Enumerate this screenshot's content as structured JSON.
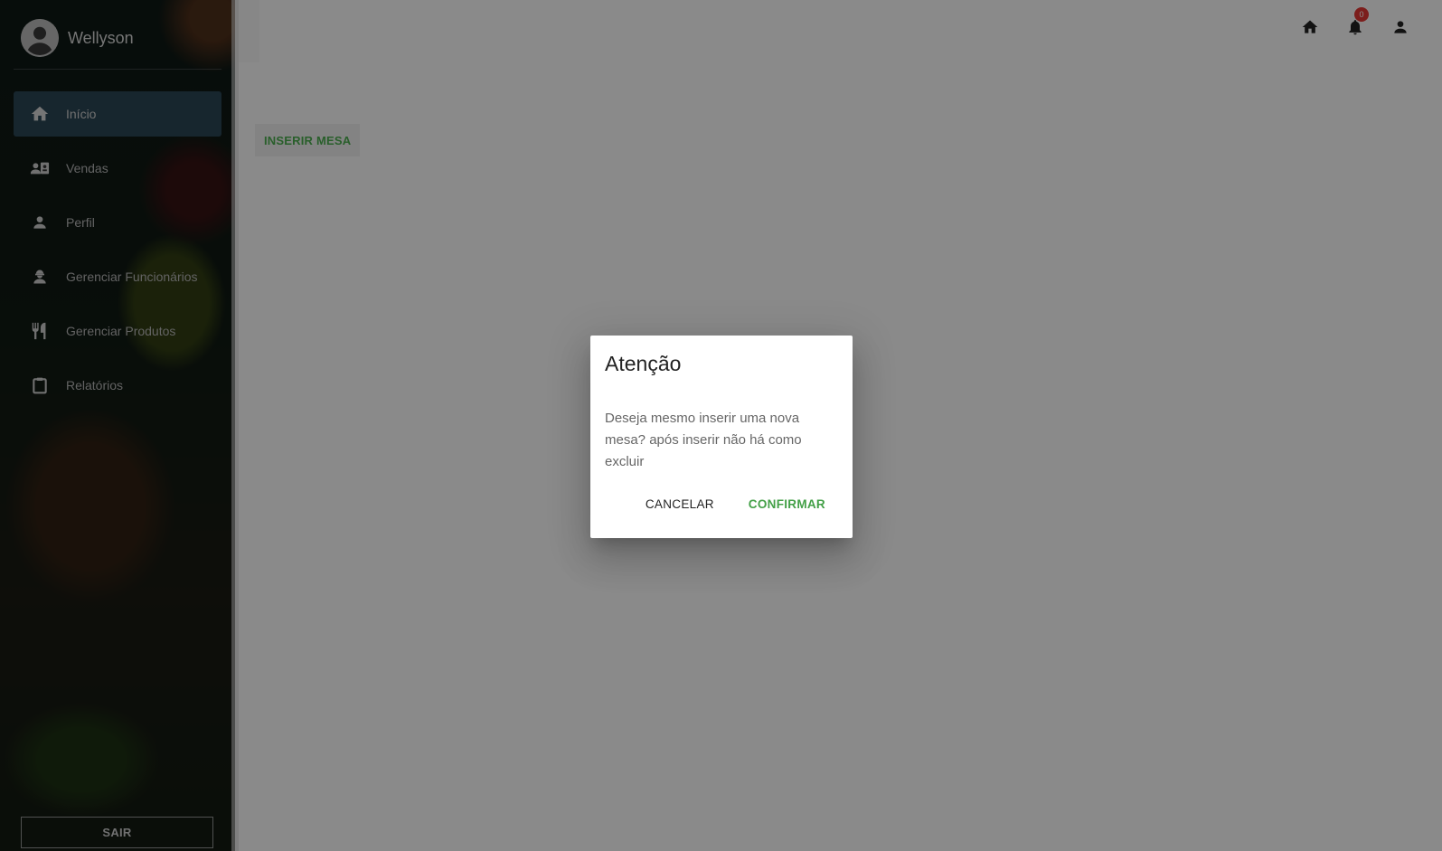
{
  "sidebar": {
    "user_name": "Wellyson",
    "items": [
      {
        "label": "Início",
        "icon": "home-icon",
        "active": true
      },
      {
        "label": "Vendas",
        "icon": "contacts-icon",
        "active": false
      },
      {
        "label": "Perfil",
        "icon": "person-icon",
        "active": false
      },
      {
        "label": "Gerenciar Funcionários",
        "icon": "engineering-icon",
        "active": false
      },
      {
        "label": "Gerenciar Produtos",
        "icon": "restaurant-icon",
        "active": false
      },
      {
        "label": "Relatórios",
        "icon": "clipboard-icon",
        "active": false
      }
    ],
    "logout_label": "SAIR"
  },
  "topbar": {
    "notification_count": "0",
    "icons": [
      "home-icon",
      "bell-icon",
      "account-icon"
    ]
  },
  "main": {
    "insert_button_label": "INSERIR MESA"
  },
  "dialog": {
    "title": "Atenção",
    "message": "Deseja mesmo inserir uma nova mesa? após inserir não há como excluir",
    "cancel_label": "CANCELAR",
    "confirm_label": "CONFIRMAR"
  },
  "colors": {
    "accent_green": "#43a047",
    "active_menu": "#2c4656",
    "badge_red": "#e53935"
  }
}
